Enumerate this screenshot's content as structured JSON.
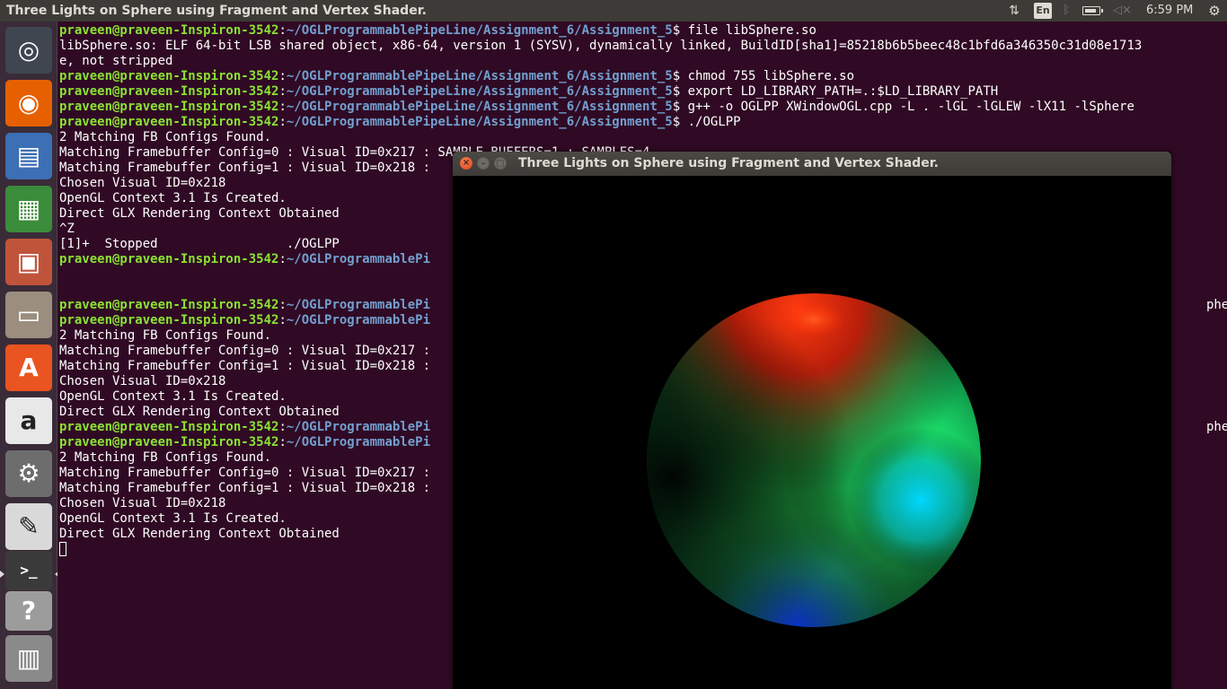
{
  "panel": {
    "active_window_title": "Three Lights on Sphere using Fragment and Vertex Shader.",
    "keyboard_layout": "En",
    "clock": "6:59 PM"
  },
  "launcher": {
    "items": [
      {
        "name": "dash-home",
        "icon": "ubuntu-logo-icon",
        "color": "#3f4650"
      },
      {
        "name": "firefox",
        "icon": "firefox-icon",
        "color": "#e66000"
      },
      {
        "name": "libreoffice-writer",
        "icon": "writer-document-icon",
        "color": "#3c6fb4"
      },
      {
        "name": "libreoffice-calc",
        "icon": "calc-spreadsheet-icon",
        "color": "#3b8c3b"
      },
      {
        "name": "libreoffice-impress",
        "icon": "impress-presentation-icon",
        "color": "#c0543b"
      },
      {
        "name": "files",
        "icon": "file-cabinet-icon",
        "color": "#9b8e7e"
      },
      {
        "name": "ubuntu-software",
        "icon": "software-bag-icon",
        "color": "#e95420"
      },
      {
        "name": "amazon",
        "icon": "amazon-icon",
        "color": "#e8e8e8"
      },
      {
        "name": "system-settings",
        "icon": "settings-wrench-icon",
        "color": "#6d6d6d"
      },
      {
        "name": "text-editor",
        "icon": "text-editor-icon",
        "color": "#d9d9d9"
      },
      {
        "name": "terminal",
        "icon": "terminal-icon",
        "color": "#3a3a3a"
      },
      {
        "name": "help",
        "icon": "help-icon",
        "color": "#9c9c9c"
      },
      {
        "name": "workspace-switcher",
        "icon": "workspace-stack-icon",
        "color": "#8a8a8a"
      }
    ]
  },
  "terminal": {
    "prompt_user": "praveen@praveen-Inspiron-3542",
    "prompt_path": "~/OGLProgrammablePipeLine/Assignment_6/Assignment_5",
    "lines": [
      {
        "type": "prompt",
        "cmd": "file libSphere.so"
      },
      {
        "type": "out",
        "text": "libSphere.so: ELF 64-bit LSB shared object, x86-64, version 1 (SYSV), dynamically linked, BuildID[sha1]=85218b6b5beec48c1bfd6a346350c31d08e1713"
      },
      {
        "type": "out",
        "text": "e, not stripped"
      },
      {
        "type": "prompt",
        "cmd": "chmod 755 libSphere.so"
      },
      {
        "type": "prompt",
        "cmd": "export LD_LIBRARY_PATH=.:$LD_LIBRARY_PATH"
      },
      {
        "type": "prompt",
        "cmd": "g++ -o OGLPP XWindowOGL.cpp -L . -lGL -lGLEW -lX11 -lSphere"
      },
      {
        "type": "prompt",
        "cmd": "./OGLPP"
      },
      {
        "type": "out",
        "text": "2 Matching FB Configs Found."
      },
      {
        "type": "out",
        "text": "Matching Framebuffer Config=0 : Visual ID=0x217 : SAMPLE_BUFFERS=1 : SAMPLES=4"
      },
      {
        "type": "out",
        "text": "Matching Framebuffer Config=1 : Visual ID=0x218 :"
      },
      {
        "type": "out",
        "text": "Chosen Visual ID=0x218"
      },
      {
        "type": "out",
        "text": "OpenGL Context 3.1 Is Created."
      },
      {
        "type": "out",
        "text": "Direct GLX Rendering Context Obtained"
      },
      {
        "type": "out",
        "text": "^Z"
      },
      {
        "type": "out",
        "text": "[1]+  Stopped                 ./OGLPP"
      },
      {
        "type": "prompt_partial",
        "path": "~/OGLProgrammablePi",
        "tail": ""
      },
      {
        "type": "blank"
      },
      {
        "type": "blank"
      },
      {
        "type": "prompt_partial",
        "path": "~/OGLProgrammablePi",
        "tail": "phere"
      },
      {
        "type": "prompt_partial",
        "path": "~/OGLProgrammablePi",
        "tail": ""
      },
      {
        "type": "out",
        "text": "2 Matching FB Configs Found."
      },
      {
        "type": "out",
        "text": "Matching Framebuffer Config=0 : Visual ID=0x217 :"
      },
      {
        "type": "out",
        "text": "Matching Framebuffer Config=1 : Visual ID=0x218 :"
      },
      {
        "type": "out",
        "text": "Chosen Visual ID=0x218"
      },
      {
        "type": "out",
        "text": "OpenGL Context 3.1 Is Created."
      },
      {
        "type": "out",
        "text": "Direct GLX Rendering Context Obtained"
      },
      {
        "type": "prompt_partial",
        "path": "~/OGLProgrammablePi",
        "tail": "phere"
      },
      {
        "type": "prompt_partial",
        "path": "~/OGLProgrammablePi",
        "tail": ""
      },
      {
        "type": "out",
        "text": "2 Matching FB Configs Found."
      },
      {
        "type": "out",
        "text": "Matching Framebuffer Config=0 : Visual ID=0x217 :"
      },
      {
        "type": "out",
        "text": "Matching Framebuffer Config=1 : Visual ID=0x218 :"
      },
      {
        "type": "out",
        "text": "Chosen Visual ID=0x218"
      },
      {
        "type": "out",
        "text": "OpenGL Context 3.1 Is Created."
      },
      {
        "type": "out",
        "text": "Direct GLX Rendering Context Obtained"
      },
      {
        "type": "cursor"
      }
    ]
  },
  "gl_window": {
    "title": "Three Lights on Sphere using Fragment and Vertex Shader.",
    "light_colors": [
      "#ff3300",
      "#00ff66",
      "#00ccff"
    ],
    "background": "#000000"
  }
}
